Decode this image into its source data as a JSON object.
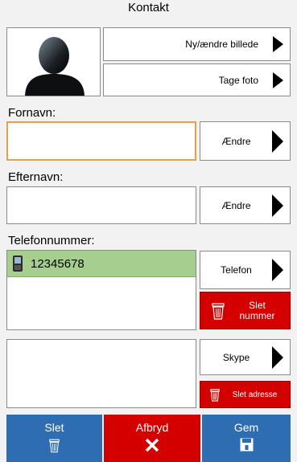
{
  "header": {
    "title": "Kontakt"
  },
  "photo": {
    "change_label": "Ny/ændre billede",
    "take_label": "Tage foto"
  },
  "first_name": {
    "label": "Fornavn:",
    "value": "",
    "button": "Ændre"
  },
  "last_name": {
    "label": "Efternavn:",
    "value": "",
    "button": "Ændre"
  },
  "phone": {
    "label": "Telefonnummer:",
    "numbers": [
      "12345678"
    ],
    "button": "Telefon",
    "delete_label_line1": "Slet",
    "delete_label_line2": "nummer"
  },
  "skype": {
    "button": "Skype",
    "delete_label": "Slet adresse"
  },
  "footer": {
    "delete_label": "Slet",
    "cancel_label": "Afbryd",
    "save_label": "Gem"
  },
  "colors": {
    "accent_blue": "#2f6db3",
    "danger_red": "#d40000",
    "selected_green": "#a6cf8f",
    "focus_orange": "#e5a04a"
  }
}
